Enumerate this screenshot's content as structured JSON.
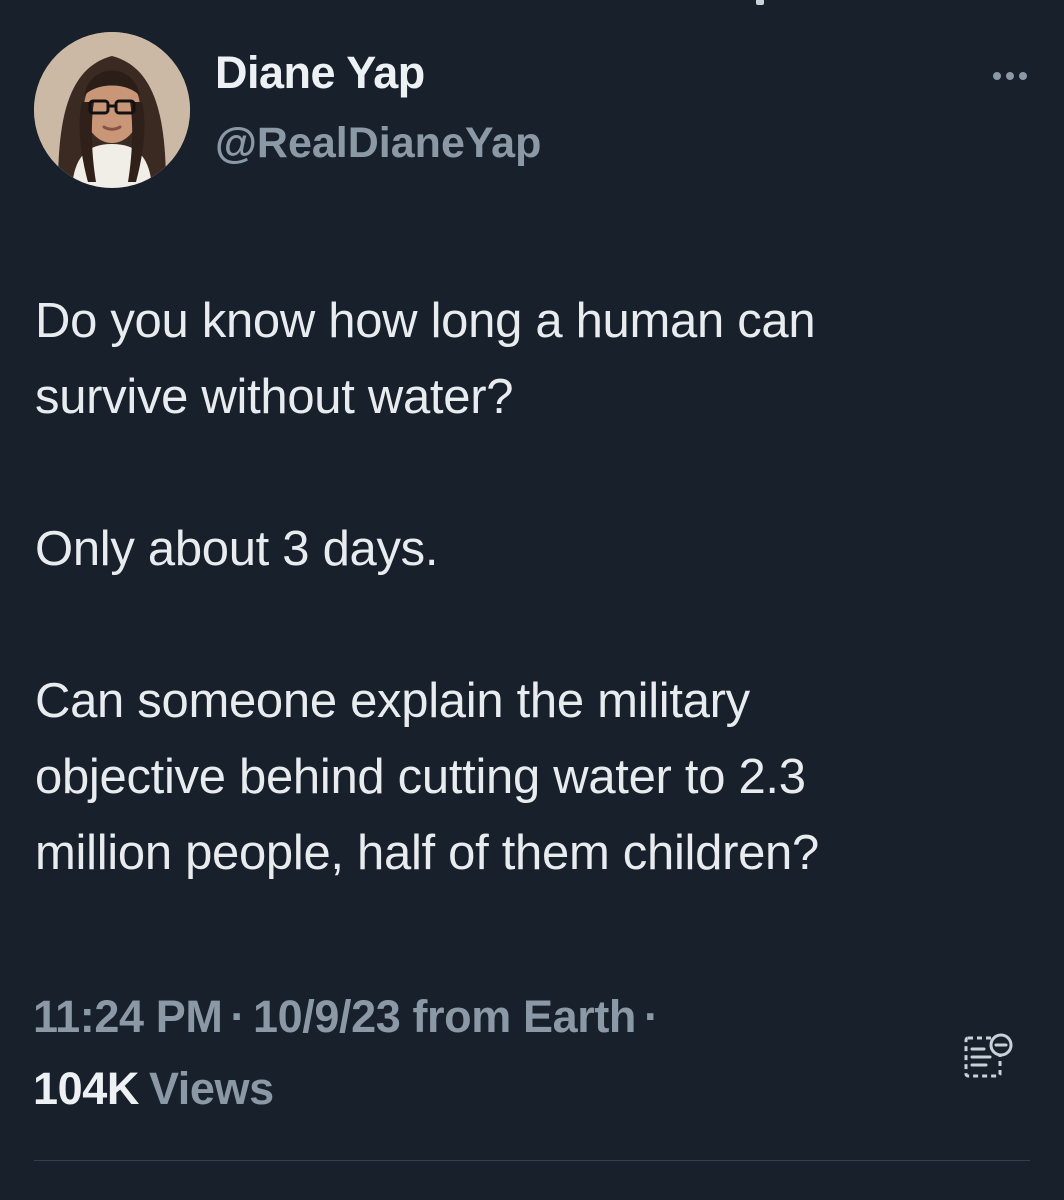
{
  "author": {
    "display_name": "Diane Yap",
    "handle": "@RealDianeYap",
    "avatar_icon": "profile-photo"
  },
  "tweet": {
    "paragraphs": [
      "Do you know how long a human can\nsurvive without water?",
      "Only about 3 days.",
      "Can someone explain the military\nobjective behind cutting water to 2.3\nmillion people, half of them children?"
    ],
    "time": "11:24 PM",
    "date": "10/9/23",
    "source": "from Earth",
    "separator": "·",
    "views_count": "104K",
    "views_label": "Views"
  },
  "actions": {
    "more_icon": "more-options-icon",
    "analytics_icon": "analytics-icon"
  },
  "theme": {
    "background": "#17202b",
    "primary_text": "#e9ecef",
    "secondary_text": "#8b98a5",
    "divider": "#34404d"
  }
}
